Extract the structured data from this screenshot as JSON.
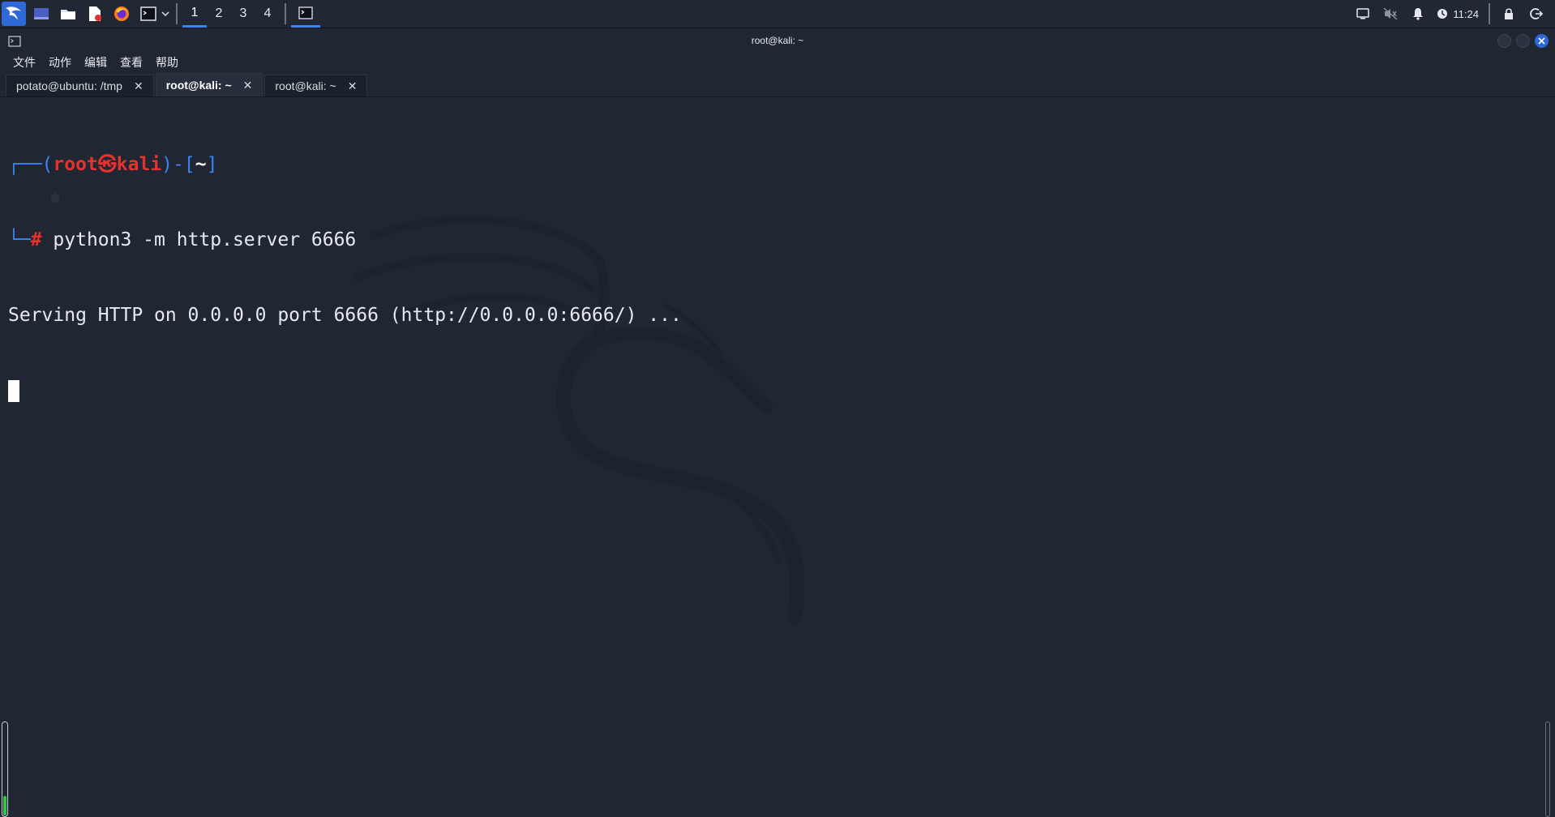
{
  "taskbar": {
    "workspaces": [
      "1",
      "2",
      "3",
      "4"
    ],
    "active_workspace_index": 0,
    "clock": "11:24",
    "icons": [
      "kali-menu-icon",
      "show-desktop-icon",
      "file-manager-icon",
      "text-editor-icon",
      "firefox-icon",
      "terminal-icon",
      "chevron-down-icon",
      "display-icon",
      "volume-muted-icon",
      "bell-icon",
      "clock-icon",
      "lock-icon",
      "logout-icon"
    ]
  },
  "window": {
    "title": "root@kali: ~",
    "menu": [
      "文件",
      "动作",
      "编辑",
      "查看",
      "帮助"
    ],
    "tabs": [
      {
        "label": "potato@ubuntu: /tmp",
        "active": false
      },
      {
        "label": "root@kali: ~",
        "active": true
      },
      {
        "label": "root@kali: ~",
        "active": false
      }
    ],
    "tab_close": "✕"
  },
  "terminal": {
    "prompt": {
      "corner_top": "┌──(",
      "user": "root",
      "at": "㉿",
      "host": "kali",
      "sep": ")-[",
      "dir": "~",
      "end": "]",
      "corner_bottom": "└─",
      "hash": "#"
    },
    "command": " python3 -m http.server 6666",
    "output": "Serving HTTP on 0.0.0.0 port 6666 (http://0.0.0.0:6666/) ..."
  },
  "colors": {
    "background": "#1f2632",
    "accent_blue": "#3b82f6",
    "prompt_red": "#e5322d"
  }
}
